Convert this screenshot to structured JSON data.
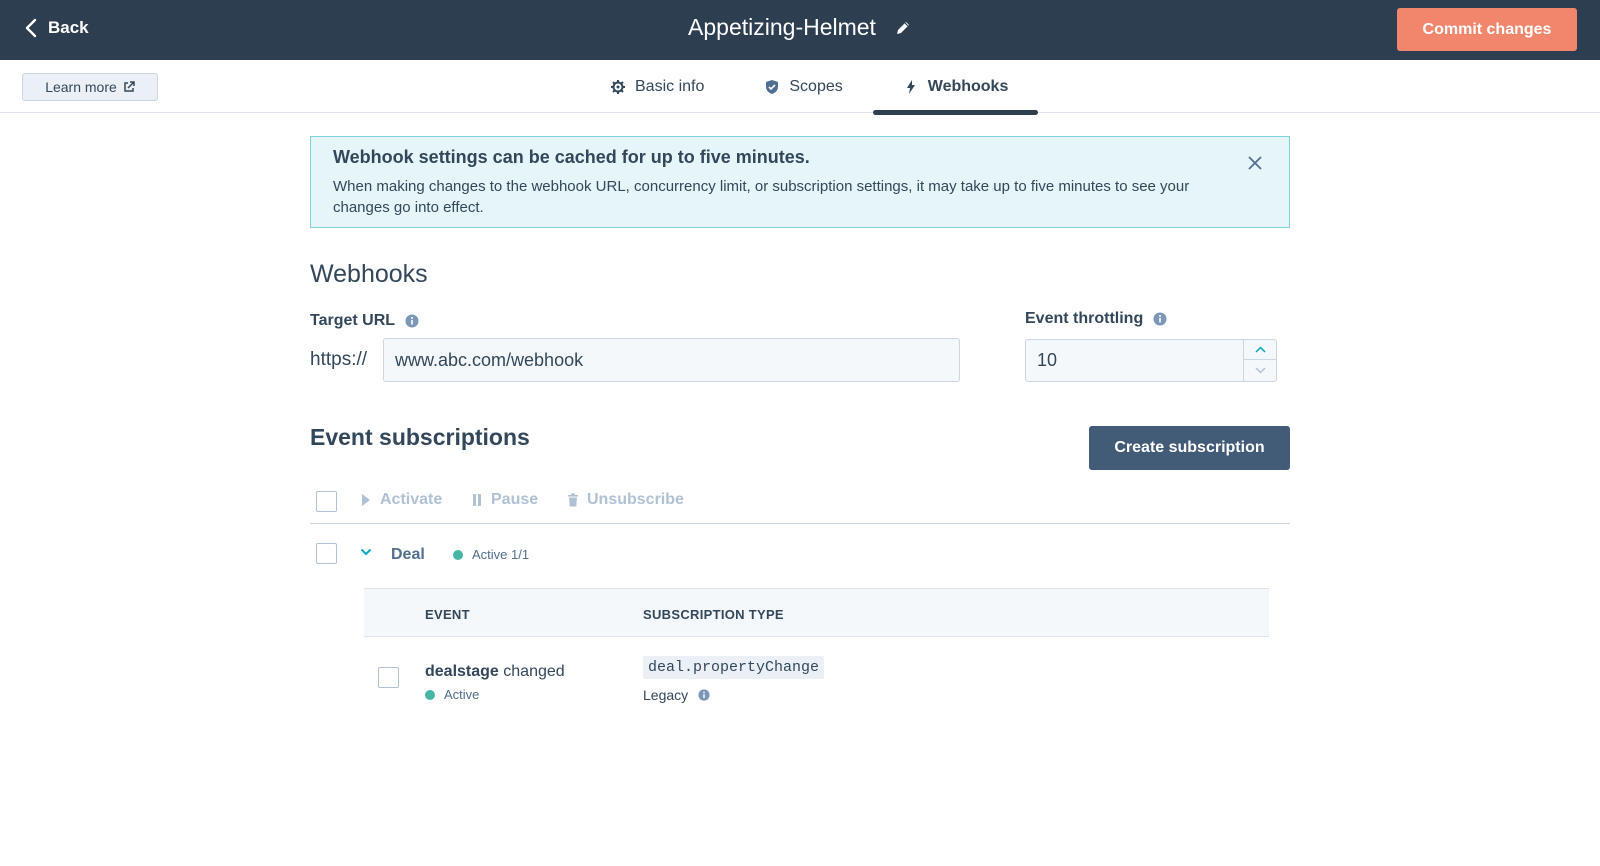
{
  "header": {
    "back_label": "Back",
    "app_title": "Appetizing-Helmet",
    "commit_label": "Commit changes"
  },
  "subnav": {
    "learn_more_label": "Learn more",
    "tabs": [
      {
        "label": "Basic info",
        "icon": "gear-icon",
        "active": false
      },
      {
        "label": "Scopes",
        "icon": "shield-icon",
        "active": false
      },
      {
        "label": "Webhooks",
        "icon": "lightning-icon",
        "active": true
      }
    ]
  },
  "alert": {
    "title": "Webhook settings can be cached for up to five minutes.",
    "body": "When making changes to the webhook URL, concurrency limit, or subscription settings, it may take up to five minutes to see your changes go into effect."
  },
  "webhooks": {
    "section_title": "Webhooks",
    "target_url_label": "Target URL",
    "url_prefix": "https://",
    "target_url_value": "www.abc.com/webhook",
    "throttling_label": "Event throttling",
    "throttling_value": "10"
  },
  "subscriptions": {
    "title": "Event subscriptions",
    "create_label": "Create subscription",
    "bulk_actions": {
      "activate": "Activate",
      "pause": "Pause",
      "unsubscribe": "Unsubscribe"
    },
    "group": {
      "name": "Deal",
      "status": "Active 1/1"
    },
    "table": {
      "col_event": "EVENT",
      "col_type": "SUBSCRIPTION TYPE",
      "rows": [
        {
          "event_property": "dealstage",
          "event_action": "changed",
          "status": "Active",
          "subscription_type": "deal.propertyChange",
          "type_note": "Legacy"
        }
      ]
    }
  },
  "colors": {
    "header_bg": "#2d3e50",
    "commit_accent": "#f2866c",
    "alert_bg": "#e5f5f8",
    "alert_border": "#7fd1de",
    "active_dot": "#45b7a4",
    "primary_button": "#425b76"
  }
}
